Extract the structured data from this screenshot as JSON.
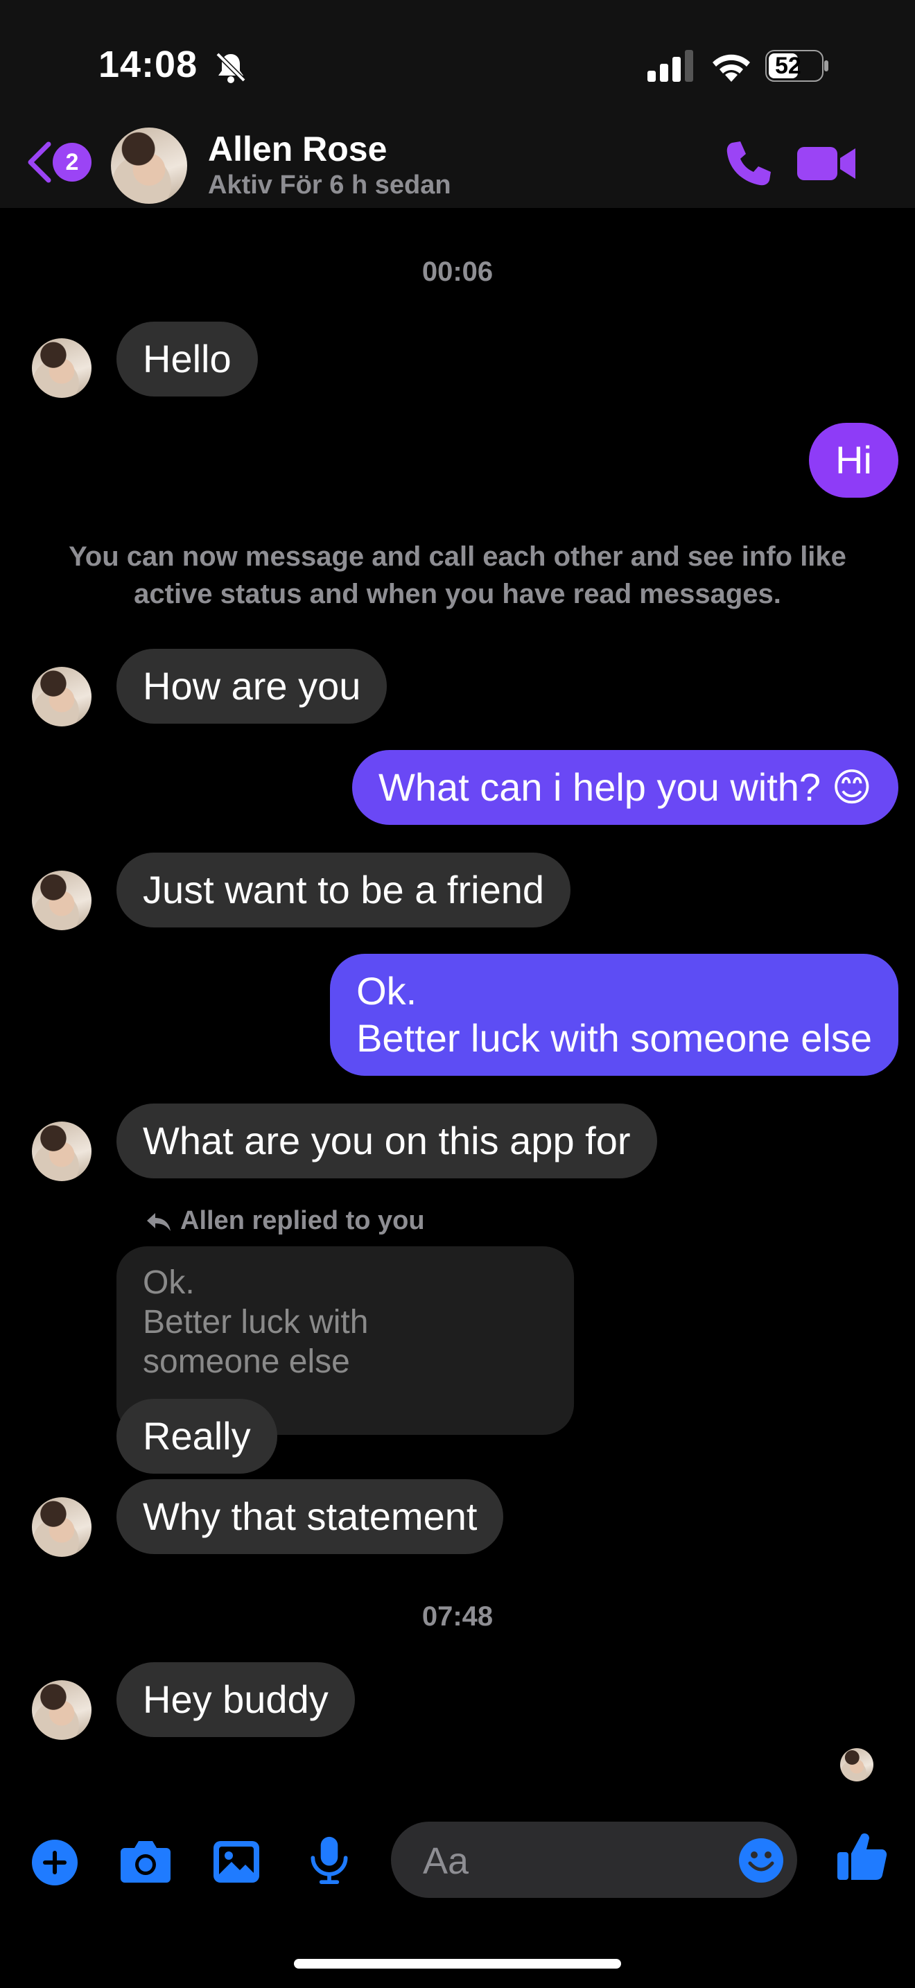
{
  "status_bar": {
    "time": "14:08",
    "battery_level": "52"
  },
  "header": {
    "back_badge_count": "2",
    "contact_name": "Allen Rose",
    "contact_status": "Aktiv För 6 h sedan",
    "accent_color": "#9b44f5"
  },
  "messages": {
    "timestamp_1": "00:06",
    "m1": "Hello",
    "m2": "Hi",
    "notice": "You can now message and call each other and see info like active status and when you have read messages.",
    "m3": "How are you",
    "m4": "What can i help you with? 😊",
    "m5": "Just want to be a friend",
    "m6_line1": "Ok.",
    "m6_line2": "Better luck with someone else",
    "m7": "What are you on this app for",
    "reply_label": "Allen replied to you",
    "quoted_text": "Ok.\nBetter luck with\nsomeone else",
    "m8": "Really",
    "m9": "Why that statement",
    "timestamp_2": "07:48",
    "m10": "Hey buddy"
  },
  "composer": {
    "placeholder": "Aa",
    "icon_color": "#1f7bff",
    "icons": [
      "plus-icon",
      "camera-icon",
      "photo-icon",
      "microphone-icon",
      "emoji-icon",
      "thumbs-up-icon"
    ]
  },
  "colors": {
    "outgoing_purple": "#8e3cf7",
    "outgoing_blue": "#5d4df4",
    "incoming_bubble": "#303030"
  }
}
